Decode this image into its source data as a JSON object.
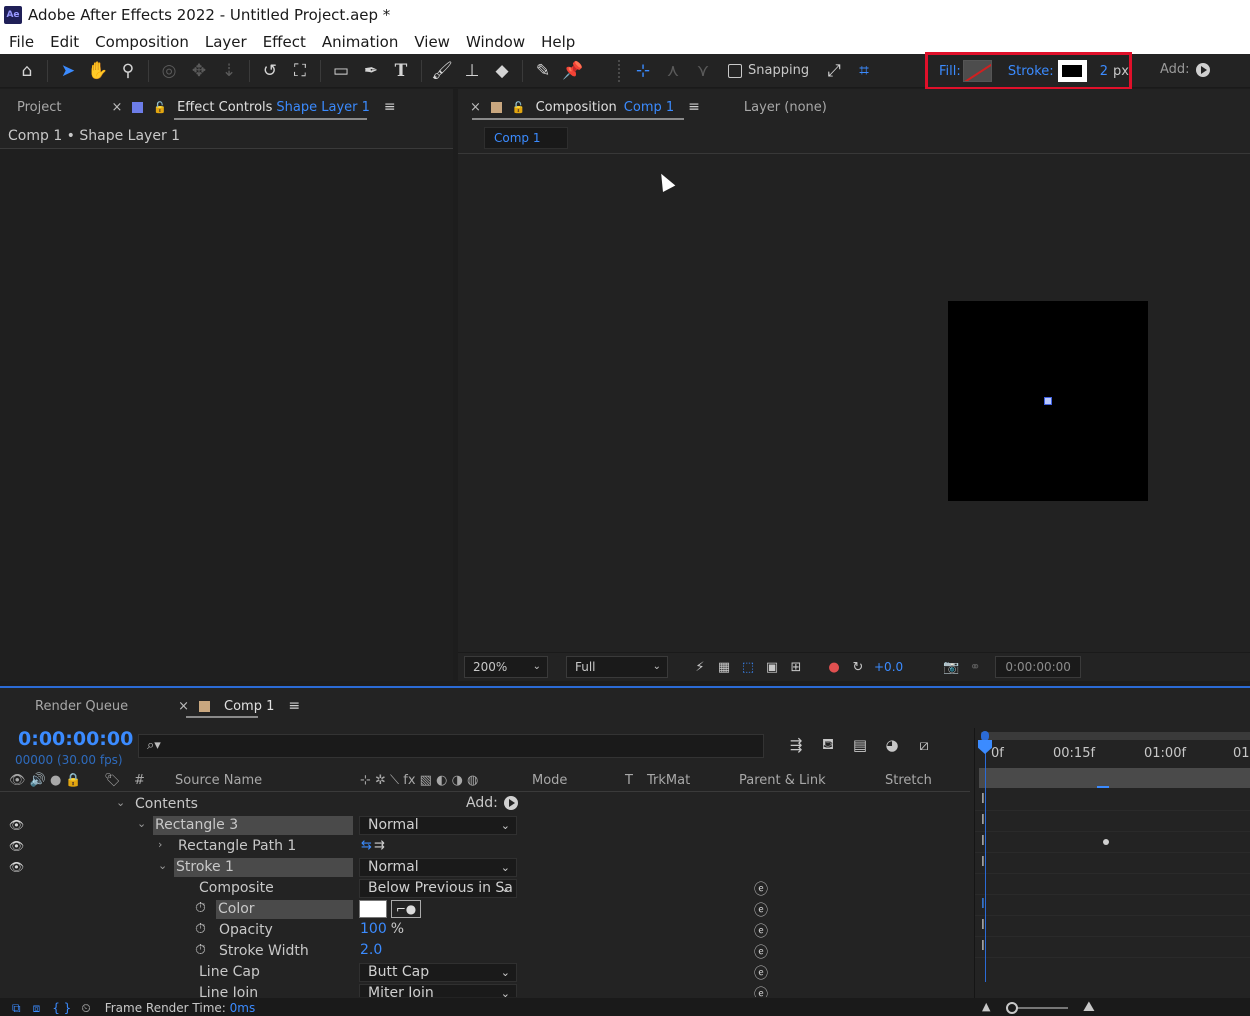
{
  "window": {
    "app_icon": "Ae",
    "title": "Adobe After Effects 2022 - Untitled Project.aep *"
  },
  "menu": [
    "File",
    "Edit",
    "Composition",
    "Layer",
    "Effect",
    "Animation",
    "View",
    "Window",
    "Help"
  ],
  "toolbar": {
    "snapping_label": "Snapping",
    "fill_label": "Fill:",
    "stroke_label": "Stroke:",
    "stroke_width": "2",
    "stroke_unit": "px",
    "add_label": "Add:",
    "highlight_color": "#e0102a"
  },
  "left_panel": {
    "project_tab": "Project",
    "effect_controls_tab": "Effect Controls",
    "effect_controls_target": "Shape Layer 1",
    "breadcrumb": "Comp 1 • Shape Layer 1"
  },
  "comp_panel": {
    "composition_tab": "Composition",
    "composition_name": "Comp 1",
    "layer_tab": "Layer (none)",
    "sub_tab": "Comp 1",
    "zoom": "200%",
    "resolution": "Full",
    "exposure": "+0.0",
    "timecode": "0:00:00:00"
  },
  "timeline": {
    "render_queue_tab": "Render Queue",
    "comp_tab": "Comp 1",
    "current_time": "0:00:00:00",
    "frame_info": "00000 (30.00 fps)",
    "search_placeholder": "⌕▾",
    "headers": {
      "hash": "#",
      "source_name": "Source Name",
      "mode": "Mode",
      "t": "T",
      "trkmat": "TrkMat",
      "parent_link": "Parent & Link",
      "stretch": "Stretch"
    },
    "rows": {
      "contents": "Contents",
      "contents_add": "Add:",
      "rectangle": "Rectangle 3",
      "rectangle_mode": "Normal",
      "rectangle_path": "Rectangle Path 1",
      "stroke": "Stroke 1",
      "stroke_mode": "Normal",
      "composite": "Composite",
      "composite_value": "Below Previous in Sa",
      "color": "Color",
      "opacity": "Opacity",
      "opacity_value": "100",
      "opacity_unit": "%",
      "stroke_width": "Stroke Width",
      "stroke_width_value": "2.0",
      "line_cap": "Line Cap",
      "line_cap_value": "Butt Cap",
      "line_join": "Line Join",
      "line_join_value": "Miter Join"
    },
    "ruler": [
      "0f",
      "00:15f",
      "01:00f",
      "01"
    ],
    "frame_render_label": "Frame Render Time:",
    "frame_render_value": "0ms"
  }
}
